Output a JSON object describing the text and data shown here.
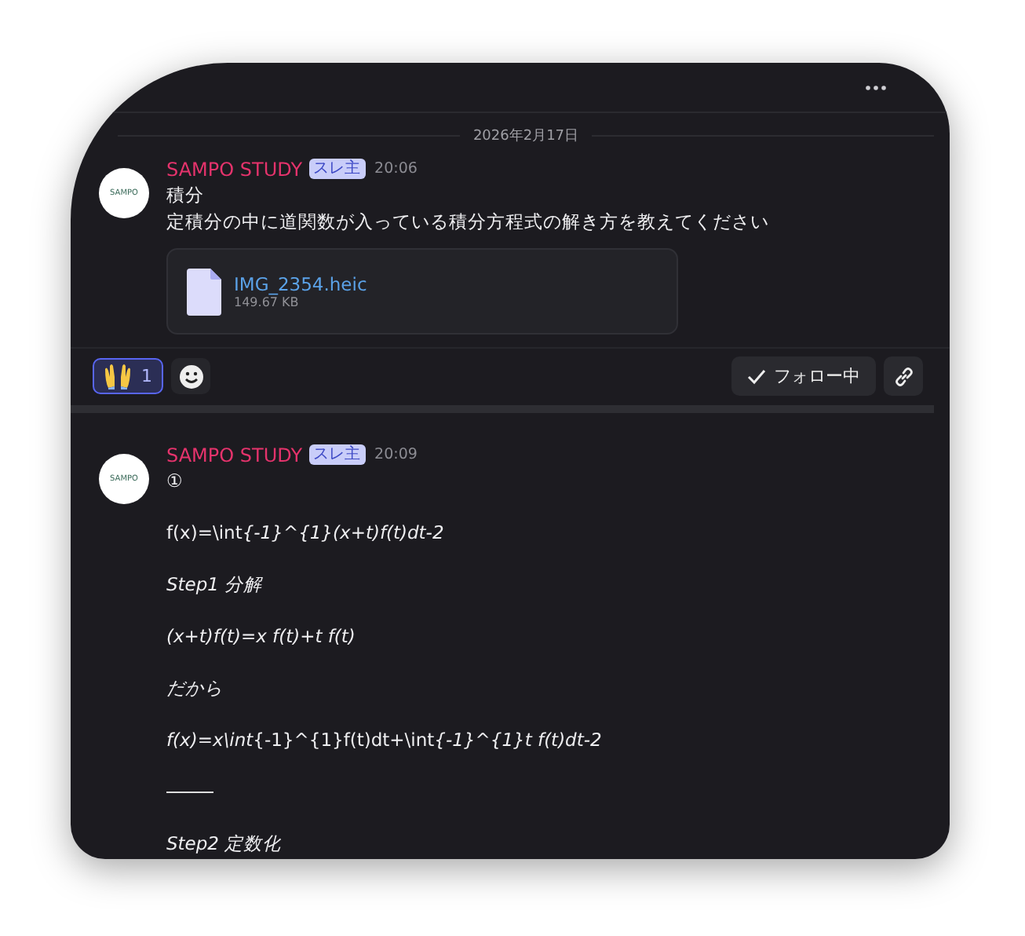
{
  "date_divider": "2026年2月17日",
  "messages": [
    {
      "author": "SAMPO STUDY",
      "badge": "スレ主",
      "time": "20:06",
      "avatar_text": "SAMPO",
      "lines": [
        {
          "kind": "text",
          "segments": [
            {
              "text": "積分",
              "italic": false
            }
          ]
        },
        {
          "kind": "text",
          "segments": [
            {
              "text": "定積分の中に道関数が入っている積分方程式の解き方を教えてください",
              "italic": false
            }
          ]
        }
      ],
      "attachment": {
        "name": "IMG_2354.heic",
        "size": "149.67 KB"
      },
      "reactions": [
        {
          "count": "1",
          "selected": true
        }
      ],
      "follow_button": "フォロー中"
    },
    {
      "author": "SAMPO STUDY",
      "badge": "スレ主",
      "time": "20:09",
      "avatar_text": "SAMPO",
      "lines": [
        {
          "kind": "text",
          "segments": [
            {
              "text": "①"
            }
          ]
        },
        {
          "kind": "blank"
        },
        {
          "kind": "text",
          "segments": [
            {
              "text": "f(x)=\\int",
              "italic": false
            },
            {
              "text": "{-1}^{1}(x+t)f(t)dt-2",
              "italic": true
            }
          ]
        },
        {
          "kind": "blank"
        },
        {
          "kind": "text",
          "segments": [
            {
              "text": "Step1 分解",
              "italic": true
            }
          ]
        },
        {
          "kind": "blank"
        },
        {
          "kind": "text",
          "segments": [
            {
              "text": "(x+t)f(t)=x f(t)+t f(t)",
              "italic": true
            }
          ]
        },
        {
          "kind": "blank"
        },
        {
          "kind": "text",
          "segments": [
            {
              "text": "だから",
              "italic": true
            }
          ]
        },
        {
          "kind": "blank"
        },
        {
          "kind": "text",
          "segments": [
            {
              "text": "f(x)=x\\int",
              "italic": true
            },
            {
              "text": "{-1}^{1}f(t)dt+\\int",
              "italic": false
            },
            {
              "text": "{-1}^{1}t f(t)dt-2",
              "italic": true
            }
          ]
        },
        {
          "kind": "blank"
        },
        {
          "kind": "rule"
        },
        {
          "kind": "blank"
        },
        {
          "kind": "text",
          "segments": [
            {
              "text": "Step2 定数化",
              "italic": true
            }
          ]
        }
      ]
    }
  ]
}
